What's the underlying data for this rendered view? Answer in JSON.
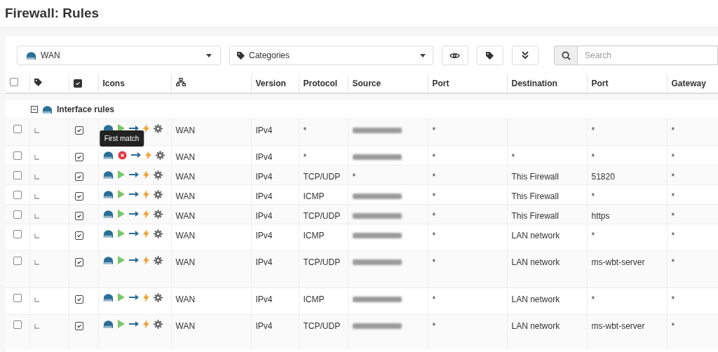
{
  "page_title": "Firewall: Rules",
  "toolbar": {
    "interface_select": "WAN",
    "category_select": "Categories",
    "search": {
      "placeholder": "Search"
    }
  },
  "table": {
    "columns": [
      "Icons",
      "Version",
      "Protocol",
      "Source",
      "Port",
      "Destination",
      "Port",
      "Gateway"
    ],
    "header_checked": false,
    "enabled_header_checked": true,
    "group": {
      "label": "Interface rules",
      "expanded": true
    },
    "rows": [
      {
        "selected": false,
        "enabled": true,
        "blocked": false,
        "interface": "WAN",
        "version": "IPv4",
        "protocol": "*",
        "source_redacted": true,
        "source_port": "*",
        "destination_port": "*",
        "gateway": "*"
      },
      {
        "selected": false,
        "enabled": true,
        "blocked": true,
        "tooltip": "First match",
        "interface": "WAN",
        "version": "IPv4",
        "protocol": "*",
        "source_redacted": true,
        "source_port": "*",
        "destination": "*",
        "destination_port": "*",
        "gateway": "*"
      },
      {
        "selected": false,
        "enabled": true,
        "blocked": false,
        "interface": "WAN",
        "version": "IPv4",
        "protocol": "TCP/UDP",
        "source": "*",
        "source_port": "*",
        "destination": "This Firewall",
        "destination_port": "51820",
        "gateway": "*"
      },
      {
        "selected": false,
        "enabled": true,
        "blocked": false,
        "interface": "WAN",
        "version": "IPv4",
        "protocol": "ICMP",
        "source_redacted": true,
        "source_port": "*",
        "destination": "This Firewall",
        "destination_port": "*",
        "gateway": "*"
      },
      {
        "selected": false,
        "enabled": true,
        "blocked": false,
        "interface": "WAN",
        "version": "IPv4",
        "protocol": "TCP/UDP",
        "source_redacted": true,
        "source_port": "*",
        "destination": "This Firewall",
        "destination_port": "https",
        "gateway": "*"
      },
      {
        "selected": false,
        "enabled": true,
        "blocked": false,
        "interface": "WAN",
        "version": "IPv4",
        "protocol": "ICMP",
        "source_redacted": true,
        "source_port": "*",
        "destination": "LAN network",
        "destination_port": "*",
        "gateway": "*"
      },
      {
        "selected": false,
        "enabled": true,
        "blocked": false,
        "interface": "WAN",
        "version": "IPv4",
        "protocol": "TCP/UDP",
        "source_redacted": true,
        "source_port": "*",
        "destination": "LAN network",
        "destination_port": "ms-wbt-server",
        "gateway": "*"
      },
      {
        "selected": false,
        "enabled": true,
        "blocked": false,
        "interface": "WAN",
        "version": "IPv4",
        "protocol": "ICMP",
        "source_redacted": true,
        "source_port": "*",
        "destination": "LAN network",
        "destination_port": "*",
        "gateway": "*"
      },
      {
        "selected": false,
        "enabled": true,
        "blocked": false,
        "interface": "WAN",
        "version": "IPv4",
        "protocol": "TCP/UDP",
        "source_redacted": true,
        "source_port": "*",
        "destination": "LAN network",
        "destination_port": "ms-wbt-server",
        "gateway": "*"
      }
    ]
  }
}
